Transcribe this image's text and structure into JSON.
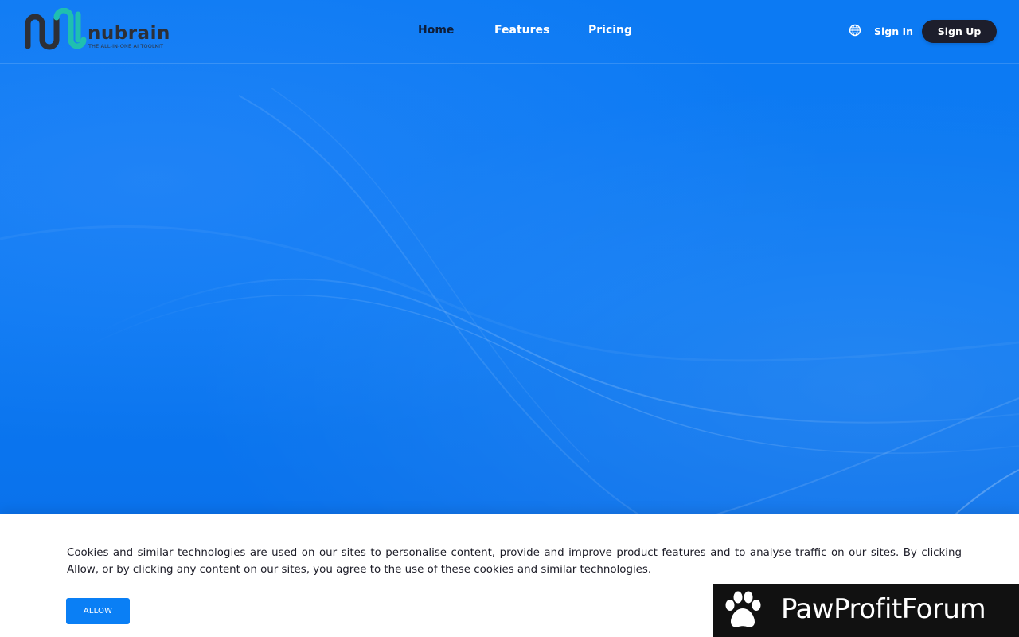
{
  "brand": {
    "name": "nubrain",
    "tagline": "THE ALL-IN-ONE AI TOOLKIT"
  },
  "nav": {
    "items": [
      {
        "label": "Home",
        "active": true
      },
      {
        "label": "Features",
        "active": false
      },
      {
        "label": "Pricing",
        "active": false
      }
    ]
  },
  "header_actions": {
    "language_icon": "globe-icon",
    "sign_in": "Sign In",
    "sign_up": "Sign Up"
  },
  "cookie_banner": {
    "message": "Cookies and similar technologies are used on our sites to personalise content, provide and improve product features and to analyse traffic on our sites. By clicking Allow, or by clicking any content on our sites, you agree to the use of these cookies and similar technologies.",
    "allow_label": "ALLOW"
  },
  "watermark": {
    "icon": "paw-icon",
    "text": "PawProfitForum"
  },
  "colors": {
    "hero_blue": "#0b79f2",
    "nav_active": "#0e1e3a",
    "signup_bg": "#1d1e2c",
    "allow_bg": "#0a7ff5",
    "logo_dark": "#2d2f36",
    "logo_teal": "#1fbfb0"
  }
}
